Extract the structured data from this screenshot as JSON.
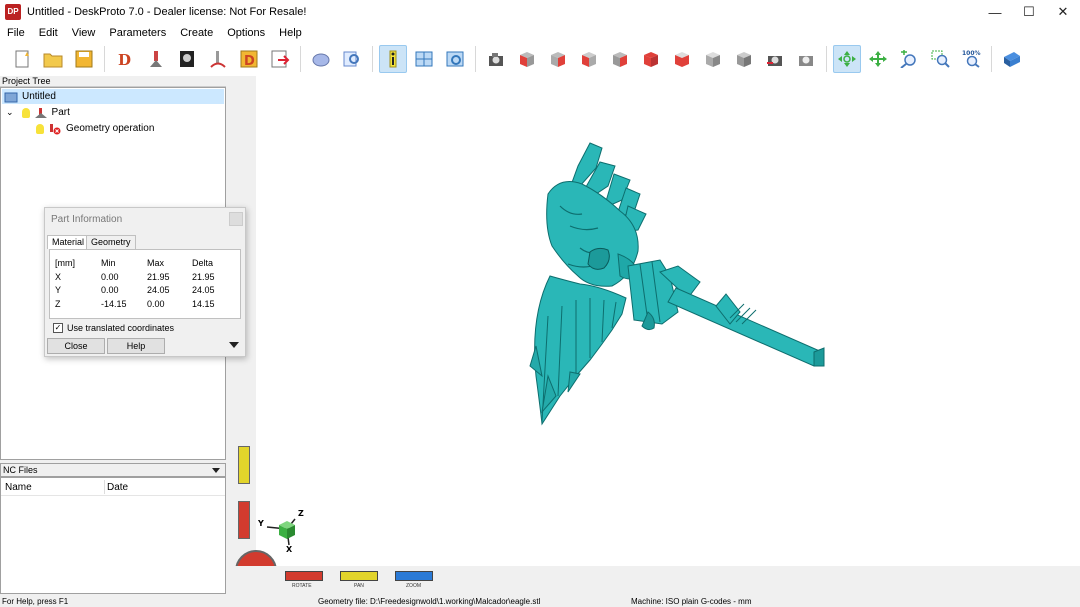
{
  "window": {
    "title": "Untitled - DeskProto 7.0 - Dealer license: Not For Resale!",
    "icon_text": "DP",
    "buttons": [
      "—",
      "☐",
      "✕"
    ]
  },
  "menu": [
    "File",
    "Edit",
    "View",
    "Parameters",
    "Create",
    "Options",
    "Help"
  ],
  "toolbar": {
    "icons": [
      "new-icon",
      "open-icon",
      "save-icon",
      "wizard-3d-icon",
      "wizard-2d-icon",
      "wizard-bitmap-icon",
      "create-toolpath-icon",
      "wizard-vector-icon",
      "export-icon",
      "simulate-icon",
      "preview-icon",
      "info-icon",
      "tile-view-icon",
      "camera-view-icon",
      "view-top-icon",
      "view-front-icon",
      "view-left-icon",
      "view-right-icon",
      "view-back-icon",
      "view-bottom-icon",
      "view-iso-icon",
      "view-iso2-icon",
      "render-icon",
      "render-alt-icon",
      "rotate-icon",
      "pan-icon",
      "zoom-in-icon",
      "zoom-window-icon",
      "zoom-100-icon",
      "help-book-icon"
    ],
    "zoom_label": "100%",
    "colors": {
      "accent": "#f2b632",
      "active": "#cce4f7",
      "cube_red": "#e0403a",
      "cube_gray": "#9a9a9a",
      "teal": "#2ab7b7"
    }
  },
  "project_tree": {
    "header": "Project Tree",
    "items": [
      {
        "label": "Untitled",
        "level": 0,
        "selected": true
      },
      {
        "label": "Part",
        "level": 1,
        "selected": false
      },
      {
        "label": "Geometry operation",
        "level": 2,
        "selected": false
      }
    ]
  },
  "part_information": {
    "title": "Part Information",
    "tabs": [
      "Material",
      "Geometry"
    ],
    "active_tab": "Material",
    "headers": [
      "[mm]",
      "Min",
      "Max",
      "Delta"
    ],
    "rows": [
      [
        "X",
        "0.00",
        "21.95",
        "21.95"
      ],
      [
        "Y",
        "0.00",
        "24.05",
        "24.05"
      ],
      [
        "Z",
        "-14.15",
        "0.00",
        "14.15"
      ]
    ],
    "use_translated": "Use translated coordinates",
    "use_translated_checked": true,
    "close_label": "Close",
    "help_label": "Help"
  },
  "nc_files": {
    "header": "NC Files",
    "columns": [
      "Name",
      "Date"
    ]
  },
  "viewport": {
    "axis_labels": [
      "Z",
      "Y",
      "X"
    ],
    "controls": [
      "ROTATE",
      "PAN",
      "ZOOM"
    ],
    "control_colors": [
      "#d23b2e",
      "#e2d42b",
      "#2b7ad6"
    ]
  },
  "status": {
    "help": "For Help, press F1",
    "geometry": "Geometry file: D:\\Freedesignwold\\1.working\\Malcador\\eagle.stl",
    "machine": "Machine: ISO plain G-codes - mm"
  }
}
